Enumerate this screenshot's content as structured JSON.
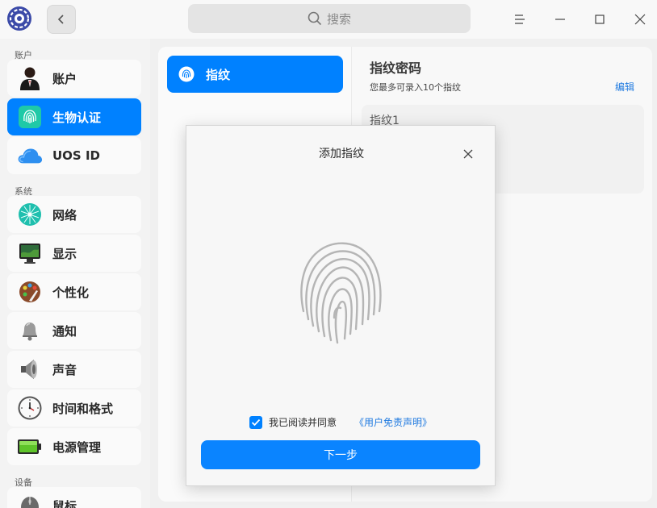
{
  "header": {
    "search_placeholder": "搜索"
  },
  "sidebar": {
    "sections": [
      {
        "label": "账户"
      },
      {
        "label": "系统"
      },
      {
        "label": "设备"
      }
    ],
    "items": [
      {
        "label": "账户",
        "icon": "user-icon"
      },
      {
        "label": "生物认证",
        "icon": "fingerprint-icon",
        "active": true
      },
      {
        "label": "UOS ID",
        "icon": "cloud-icon"
      },
      {
        "label": "网络",
        "icon": "network-icon"
      },
      {
        "label": "显示",
        "icon": "display-icon"
      },
      {
        "label": "个性化",
        "icon": "palette-icon"
      },
      {
        "label": "通知",
        "icon": "bell-icon"
      },
      {
        "label": "声音",
        "icon": "speaker-icon"
      },
      {
        "label": "时间和格式",
        "icon": "clock-icon"
      },
      {
        "label": "电源管理",
        "icon": "battery-icon"
      },
      {
        "label": "鼠标",
        "icon": "mouse-icon"
      }
    ]
  },
  "middle": {
    "tab_label": "指纹"
  },
  "right": {
    "title": "指纹密码",
    "subtitle": "您最多可录入10个指纹",
    "edit_label": "编辑",
    "fingerprints": [
      "指纹1"
    ]
  },
  "dialog": {
    "title": "添加指纹",
    "agree_text": "我已阅读并同意",
    "disclaimer_link": "《用户免责声明》",
    "agree_checked": true,
    "next_label": "下一步"
  },
  "colors": {
    "accent": "#0081ff",
    "link": "#1f7ae0"
  }
}
